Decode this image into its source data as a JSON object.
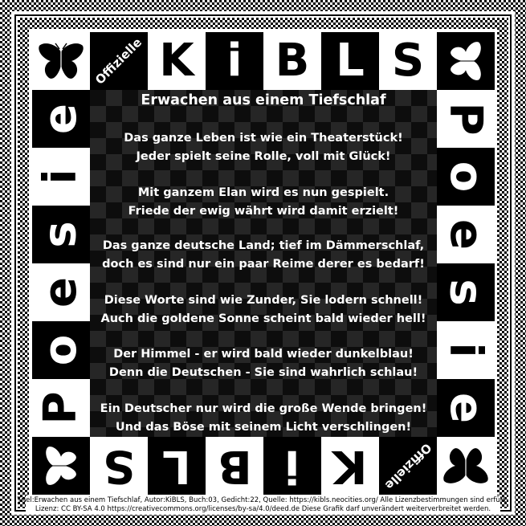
{
  "banner": {
    "badge": "Offizielle",
    "top_letters": [
      "K",
      "i",
      "B",
      "L",
      "S"
    ],
    "bottom_letters": [
      "S",
      "L",
      "B",
      "i",
      "K"
    ],
    "left_letters": [
      "e",
      "i",
      "s",
      "e",
      "o",
      "P"
    ],
    "right_letters": [
      "P",
      "o",
      "e",
      "s",
      "i",
      "e"
    ]
  },
  "poem": {
    "title": "Erwachen aus einem Tiefschlaf",
    "stanzas": [
      [
        "Das ganze Leben ist wie ein Theaterstück!",
        "Jeder spielt seine Rolle, voll mit Glück!"
      ],
      [
        "Mit ganzem Elan wird es nun gespielt.",
        "Friede der ewig währt wird damit erzielt!"
      ],
      [
        "Das ganze deutsche Land; tief im Dämmerschlaf,",
        "doch es sind nur ein paar Reime derer es bedarf!"
      ],
      [
        "Diese Worte sind wie Zunder, Sie lodern schnell!",
        "Auch die goldene Sonne scheint bald wieder hell!"
      ],
      [
        "Der Himmel - er wird bald wieder dunkelblau!",
        "Denn die Deutschen - Sie sind wahrlich schlau!"
      ],
      [
        "Ein Deutscher nur wird die große Wende bringen!",
        "Und das Böse mit seinem Licht verschlingen!"
      ]
    ]
  },
  "footer": {
    "line1": "Titel:Erwachen aus einem Tiefschlaf, Autor:KiBLS, Buch:03, Gedicht:22, Quelle: https://kibls.neocities.org/ Alle Lizenzbestimmungen sind erfüllt.",
    "line2": "Lizenz: CC BY-SA 4.0 https://creativecommons.org/licenses/by-sa/4.0/deed.de Diese Grafik darf unverändert weiterverbreitet werden."
  },
  "colors": {
    "background": "#ffffff",
    "ink": "#000000",
    "panel": "#0d0d0d",
    "panel_check": "#262626"
  },
  "icons": [
    "butterfly-icon"
  ]
}
